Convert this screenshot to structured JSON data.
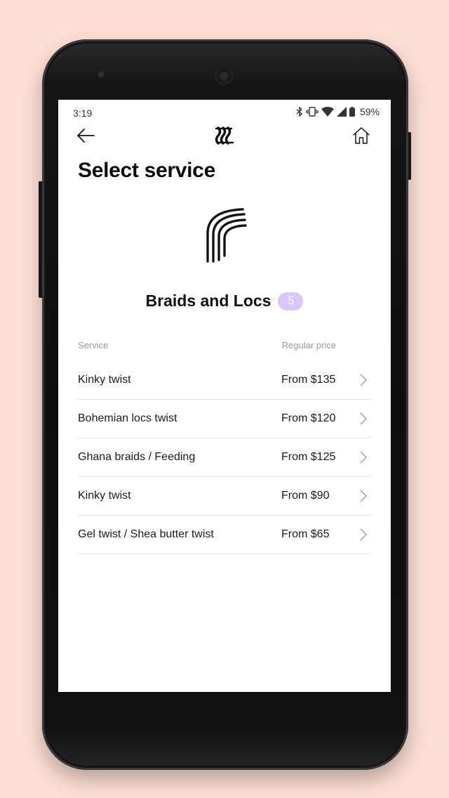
{
  "status_bar": {
    "time": "3:19",
    "battery_percent": "59%",
    "icons": [
      "bluetooth-icon",
      "vibrate-icon",
      "wifi-icon",
      "signal-icon",
      "battery-icon"
    ]
  },
  "nav": {
    "back_icon": "arrow-left-icon",
    "logo_icon": "brand-logo-icon",
    "home_icon": "home-icon"
  },
  "page": {
    "title": "Select service"
  },
  "category": {
    "icon": "braids-icon",
    "title": "Braids and Locs",
    "count": "5",
    "badge_color": "#d9c6fb"
  },
  "table": {
    "header_service": "Service",
    "header_price": "Regular price",
    "rows": [
      {
        "name": "Kinky twist",
        "price": "From $135"
      },
      {
        "name": "Bohemian locs twist",
        "price": "From $120"
      },
      {
        "name": "Ghana braids / Feeding",
        "price": "From $125"
      },
      {
        "name": "Kinky twist",
        "price": "From $90"
      },
      {
        "name": "Gel twist / Shea butter twist",
        "price": "From $65"
      }
    ]
  },
  "colors": {
    "background": "#fde0d3",
    "badge": "#d9c6fb"
  }
}
